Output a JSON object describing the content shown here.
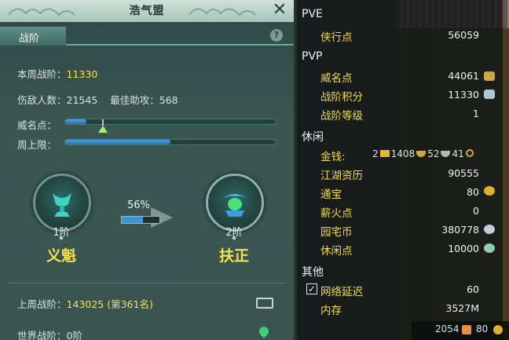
{
  "window": {
    "title": "浩气盟"
  },
  "tabs": [
    {
      "label": "战阶"
    }
  ],
  "stats": {
    "weekly_rank_label": "本周战阶：",
    "weekly_rank_value": "11330",
    "kills_label": "伤敌人数：",
    "kills_value": "21545",
    "assist_label": "最佳助攻：",
    "assist_value": "568",
    "prestige_label": "威名点：",
    "prestige_fraction": 0.1,
    "cap_label": "周上限：",
    "cap_fraction": 0.5
  },
  "ranks": {
    "current": {
      "num": "1阶",
      "name": "义魁"
    },
    "next": {
      "num": "2阶",
      "name": "扶正"
    },
    "progress_label": "56%",
    "progress_fraction": 0.56
  },
  "history": {
    "last_week_label": "上周战阶：",
    "last_week_value": "143025 (第361名)",
    "world_label": "世界战阶：",
    "world_value": "0阶"
  },
  "side": {
    "pve_header": "PVE",
    "pvp_header": "PVP",
    "idle_header": "休闲",
    "other_header": "其他",
    "pve": [
      {
        "label": "侠行点",
        "value": "56059"
      }
    ],
    "pvp": [
      {
        "label": "威名点",
        "value": "44061"
      },
      {
        "label": "战阶积分",
        "value": "11330"
      },
      {
        "label": "战阶等级",
        "value": "1"
      }
    ],
    "idle": [
      {
        "label": "金钱:",
        "value": ""
      },
      {
        "label": "江湖资历",
        "value": "90555"
      },
      {
        "label": "通宝",
        "value": "80"
      },
      {
        "label": "薪火点",
        "value": "0"
      },
      {
        "label": "园宅币",
        "value": "380778"
      },
      {
        "label": "休闲点",
        "value": "10000"
      }
    ],
    "money": {
      "gold": "2",
      "silver": "1408",
      "copper": "52",
      "bronze": "41"
    },
    "other": [
      {
        "label": "网络延迟",
        "value": "60"
      },
      {
        "label": "内存",
        "value": "3527M"
      }
    ],
    "footer_val1": "2054",
    "footer_val2": "80",
    "colors": {
      "accent_yellow": "#f3e34a",
      "bar_blue": "#3a93dc"
    }
  }
}
